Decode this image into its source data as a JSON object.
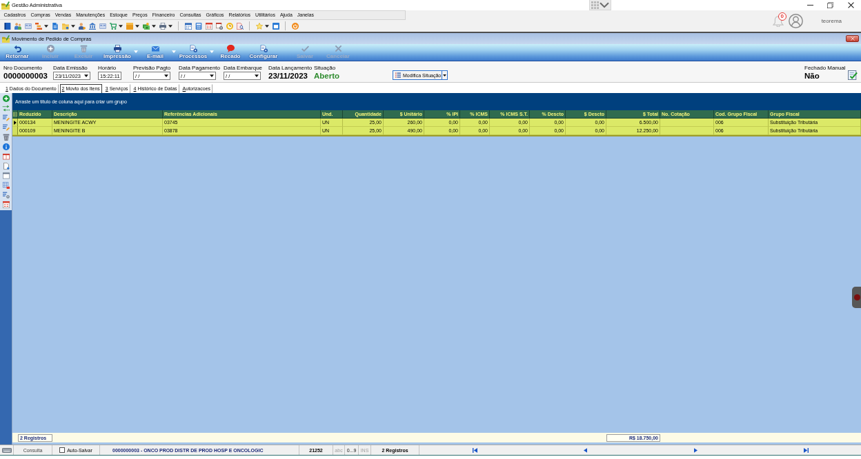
{
  "app_window": {
    "title": "Gestão Administrativa"
  },
  "menu_bar": [
    "Cadastros",
    "Compras",
    "Vendas",
    "Manutenções",
    "Estoque",
    "Preços",
    "Financeiro",
    "Consultas",
    "Gráficos",
    "Relatórios",
    "Utilitários",
    "Ajuda",
    "Janelas"
  ],
  "user_area": {
    "notification_count": "0",
    "user_name": "teorema"
  },
  "document_window": {
    "title": "Movimento de Pedido de Compras"
  },
  "toolbar": [
    {
      "label": "Retornar",
      "disabled": false,
      "dropdown": false
    },
    {
      "label": "Incluir",
      "disabled": true,
      "dropdown": false
    },
    {
      "label": "Excluir",
      "disabled": true,
      "dropdown": false
    },
    {
      "label": "Impressão",
      "disabled": false,
      "dropdown": true
    },
    {
      "label": "E-mail",
      "disabled": false,
      "dropdown": true
    },
    {
      "label": "Processos",
      "disabled": false,
      "dropdown": true
    },
    {
      "label": "Recado",
      "disabled": false,
      "dropdown": false
    },
    {
      "label": "Configurar",
      "disabled": false,
      "dropdown": false
    },
    {
      "label": "Salvar",
      "disabled": true,
      "dropdown": false
    },
    {
      "label": "Cancelar",
      "disabled": true,
      "dropdown": false
    }
  ],
  "header_fields": [
    {
      "kind": "text",
      "label": "Nro Documento",
      "value": "0000000003"
    },
    {
      "kind": "date",
      "label": "Data Emissão",
      "value": "23/11/2023"
    },
    {
      "kind": "time",
      "label": "Horário",
      "value": "15:22:11"
    },
    {
      "kind": "date",
      "label": "Previsão Pagto",
      "value": "/ /"
    },
    {
      "kind": "date",
      "label": "Data Pagamento",
      "value": "/ /"
    },
    {
      "kind": "date",
      "label": "Data Embarque",
      "value": "/ /"
    },
    {
      "kind": "text",
      "label": "Data Lançamento",
      "value": "23/11/2023"
    },
    {
      "kind": "status",
      "label": "Situação",
      "value": "Aberto"
    }
  ],
  "status_button": {
    "label": "Modifica Situação"
  },
  "manual_close": {
    "label": "Fechado Manual",
    "value": "Não"
  },
  "tabs": [
    {
      "label": "1 Dados do Documento",
      "selected": false
    },
    {
      "label": "2 Movto dos Itens",
      "selected": true
    },
    {
      "label": "3 Serviços",
      "selected": false
    },
    {
      "label": "4 Histórico de Datas",
      "selected": false
    },
    {
      "label": "Autorizacoes",
      "selected": false
    }
  ],
  "grid": {
    "group_hint": "Arraste um título de coluna aqui para criar um grupo",
    "columns": [
      {
        "label": "Reduzido",
        "kind": "text"
      },
      {
        "label": "Descrição",
        "kind": "text"
      },
      {
        "label": "Referências Adicionais",
        "kind": "text"
      },
      {
        "label": "Und.",
        "kind": "text"
      },
      {
        "label": "Quantidade",
        "kind": "number"
      },
      {
        "label": "$ Unitário",
        "kind": "number"
      },
      {
        "label": "% IPI",
        "kind": "number"
      },
      {
        "label": "% ICMS",
        "kind": "number"
      },
      {
        "label": "% ICMS S.T.",
        "kind": "number"
      },
      {
        "label": "% Descto",
        "kind": "number"
      },
      {
        "label": "$ Descto",
        "kind": "number"
      },
      {
        "label": "$ Total",
        "kind": "number"
      },
      {
        "label": "No. Cotação",
        "kind": "text"
      },
      {
        "label": "Cod. Grupo Fiscal",
        "kind": "text"
      },
      {
        "label": "Grupo Fiscal",
        "kind": "text"
      }
    ],
    "rows": [
      {
        "selected": true,
        "cells": [
          "000134",
          "MENINGITE ACWY",
          "03745",
          "UN",
          "25,00",
          "260,00",
          "0,00",
          "0,00",
          "0,00",
          "0,00",
          "0,00",
          "6.500,00",
          null,
          "006",
          "Substituição Tributária"
        ]
      },
      {
        "selected": false,
        "cells": [
          "000109",
          "MENINGITE B",
          "03878",
          "UN",
          "25,00",
          "490,00",
          "0,00",
          "0,00",
          "0,00",
          "0,00",
          "0,00",
          "12.250,00",
          null,
          "006",
          "Substituição Tributária"
        ]
      }
    ],
    "footer": {
      "count": "2 Registros",
      "total": "R$ 18.750,00"
    }
  },
  "status_bar": {
    "mode": "Consulta",
    "auto_save": {
      "label": "Auto-Salvar",
      "checked": false
    },
    "supplier": "0000000003 - ONCO PROD DISTR DE PROD HOSP E ONCOLOGIC",
    "code": "21252",
    "indicators": [
      {
        "label": "abc",
        "on": false
      },
      {
        "label": "0...9",
        "on": true
      },
      {
        "label": "INS",
        "on": false
      }
    ],
    "records": "2 Registros"
  }
}
